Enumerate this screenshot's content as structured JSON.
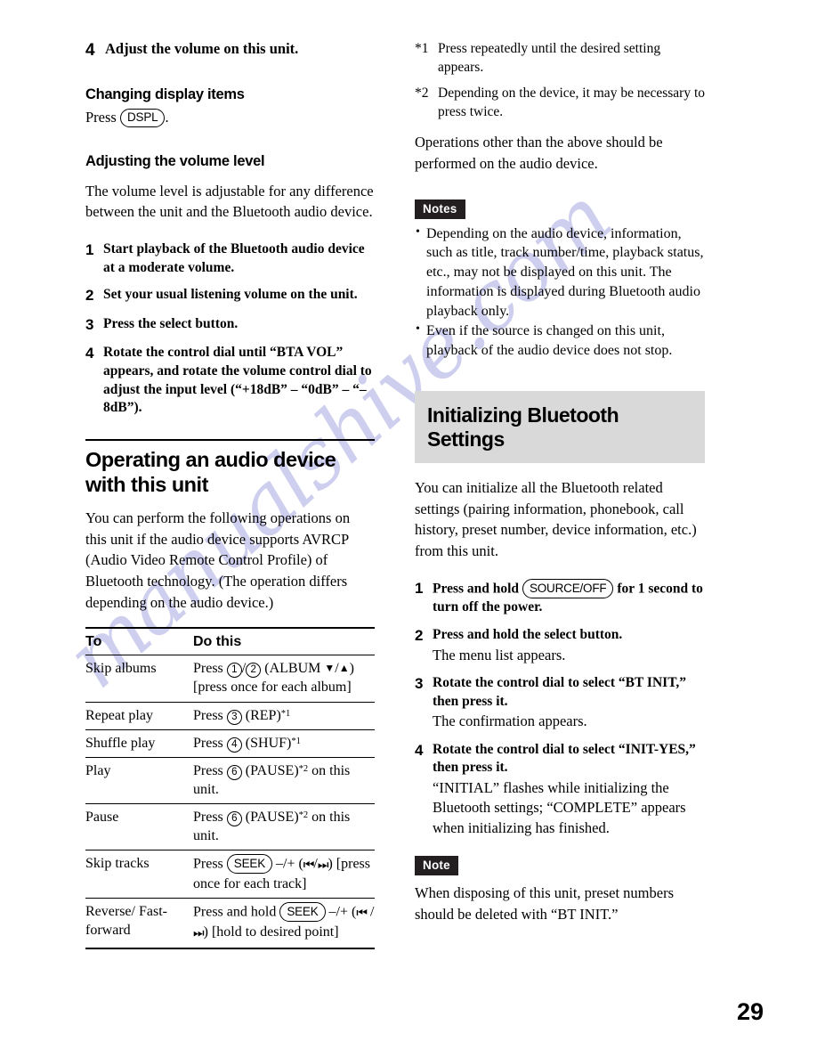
{
  "watermark": {
    "text": "manualshive.com",
    "color": "#8b8ed8"
  },
  "page_number": "29",
  "left_column": {
    "top_step": {
      "num": "4",
      "text": "Adjust the volume on this unit."
    },
    "subhead_display": "Changing display items",
    "display_press_prefix": "Press",
    "display_button": "DSPL",
    "display_press_suffix": ".",
    "subhead_volume": "Adjusting the volume level",
    "volume_intro": "The volume level is adjustable for any difference between the unit and the Bluetooth audio device.",
    "volume_steps": [
      {
        "num": "1",
        "text": "Start playback of the Bluetooth audio device at a moderate volume."
      },
      {
        "num": "2",
        "text": "Set your usual listening volume on the unit."
      },
      {
        "num": "3",
        "text": "Press the select button."
      },
      {
        "num": "4",
        "text": "Rotate the control dial until “BTA VOL” appears, and rotate the volume control dial to adjust the input level (“+18dB” – “0dB” – “– 8dB”)."
      }
    ],
    "section_heading": "Operating an audio device with this unit",
    "section_intro": "You can perform the following operations on this unit if the audio device supports AVRCP (Audio Video Remote Control Profile) of Bluetooth technology. (The operation differs depending on the audio device.)",
    "table": {
      "headers": [
        "To",
        "Do this"
      ],
      "rows": [
        {
          "to": "Skip albums",
          "do_parts": [
            {
              "type": "text",
              "value": "Press "
            },
            {
              "type": "circnum",
              "value": "1"
            },
            {
              "type": "text",
              "value": "/"
            },
            {
              "type": "circnum",
              "value": "2"
            },
            {
              "type": "text",
              "value": " (ALBUM "
            },
            {
              "type": "tri",
              "value": "▼"
            },
            {
              "type": "text",
              "value": "/"
            },
            {
              "type": "tri",
              "value": "▲"
            },
            {
              "type": "text",
              "value": ") [press once for each album]"
            }
          ]
        },
        {
          "to": "Repeat play",
          "do_parts": [
            {
              "type": "text",
              "value": "Press "
            },
            {
              "type": "circnum",
              "value": "3"
            },
            {
              "type": "text",
              "value": " (REP)"
            },
            {
              "type": "sup",
              "value": "*1"
            }
          ]
        },
        {
          "to": "Shuffle play",
          "do_parts": [
            {
              "type": "text",
              "value": "Press "
            },
            {
              "type": "circnum",
              "value": "4"
            },
            {
              "type": "text",
              "value": " (SHUF)"
            },
            {
              "type": "sup",
              "value": "*1"
            }
          ]
        },
        {
          "to": "Play",
          "do_parts": [
            {
              "type": "text",
              "value": "Press "
            },
            {
              "type": "circnum",
              "value": "6"
            },
            {
              "type": "text",
              "value": " (PAUSE)"
            },
            {
              "type": "sup",
              "value": "*2"
            },
            {
              "type": "text",
              "value": " on this unit."
            }
          ]
        },
        {
          "to": "Pause",
          "do_parts": [
            {
              "type": "text",
              "value": "Press "
            },
            {
              "type": "circnum",
              "value": "6"
            },
            {
              "type": "text",
              "value": " (PAUSE)"
            },
            {
              "type": "sup",
              "value": "*2"
            },
            {
              "type": "text",
              "value": " on this unit."
            }
          ]
        },
        {
          "to": "Skip tracks",
          "do_parts": [
            {
              "type": "text",
              "value": "Press "
            },
            {
              "type": "pill",
              "value": "SEEK"
            },
            {
              "type": "text",
              "value": " –/+ ("
            },
            {
              "type": "seek",
              "value": "⏮"
            },
            {
              "type": "text",
              "value": "/"
            },
            {
              "type": "seek",
              "value": "⏭"
            },
            {
              "type": "text",
              "value": ") [press once for each track]"
            }
          ]
        },
        {
          "to": "Reverse/ Fast-forward",
          "do_parts": [
            {
              "type": "text",
              "value": "Press and hold "
            },
            {
              "type": "pill",
              "value": "SEEK"
            },
            {
              "type": "text",
              "value": " –/+ ("
            },
            {
              "type": "seek",
              "value": "⏮"
            },
            {
              "type": "text",
              "value": " /"
            },
            {
              "type": "seek",
              "value": "⏭"
            },
            {
              "type": "text",
              "value": ") [hold to desired point]"
            }
          ]
        }
      ]
    }
  },
  "right_column": {
    "footnotes": [
      {
        "mark": "*1",
        "text": "Press repeatedly until the desired setting appears."
      },
      {
        "mark": "*2",
        "text": "Depending on the device, it may be necessary to press twice."
      }
    ],
    "operations_note": "Operations other than the above should be performed on the audio device.",
    "notes_badge": "Notes",
    "notes_items": [
      "Depending on the audio device, information, such as title, track number/time, playback status, etc., may not be displayed on this unit. The information is displayed during Bluetooth audio playback only.",
      "Even if the source is changed on this unit, playback of the audio device does not stop."
    ],
    "section_heading": "Initializing Bluetooth Settings",
    "section_intro": "You can initialize all the Bluetooth related settings (pairing information, phonebook, call history, preset number, device information, etc.) from this unit.",
    "steps": [
      {
        "num": "1",
        "parts": [
          {
            "type": "text",
            "value": "Press and hold "
          },
          {
            "type": "pill",
            "value": "SOURCE/OFF"
          },
          {
            "type": "text",
            "value": " for 1 second to turn off the power."
          }
        ],
        "sub": ""
      },
      {
        "num": "2",
        "parts": [
          {
            "type": "text",
            "value": "Press and hold the select button."
          }
        ],
        "sub": "The menu list appears."
      },
      {
        "num": "3",
        "parts": [
          {
            "type": "text",
            "value": "Rotate the control dial to select “BT INIT,” then press it."
          }
        ],
        "sub": "The confirmation appears."
      },
      {
        "num": "4",
        "parts": [
          {
            "type": "text",
            "value": "Rotate the control dial to select “INIT-YES,” then press it."
          }
        ],
        "sub": "“INITIAL” flashes while initializing the Bluetooth settings; “COMPLETE” appears when initializing has finished."
      }
    ],
    "note_badge": "Note",
    "note_text": "When disposing of this unit, preset numbers should be deleted with “BT INIT.”"
  }
}
